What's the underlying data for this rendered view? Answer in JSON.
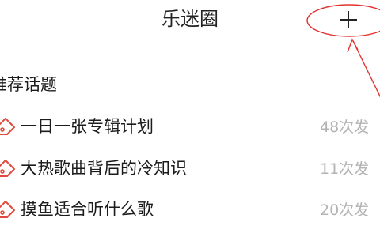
{
  "header": {
    "title": "乐迷圈",
    "add_icon": "plus-icon"
  },
  "section": {
    "title": "推荐话题"
  },
  "topics": [
    {
      "name": "一日一张专辑计划",
      "count": "48次发",
      "icon": "tag-icon"
    },
    {
      "name": "大热歌曲背后的冷知识",
      "count": "11次发",
      "icon": "tag-icon"
    },
    {
      "name": "摸鱼适合听什么歌",
      "count": "20次发",
      "icon": "tag-icon"
    }
  ],
  "colors": {
    "annotation_red": "#e2332f",
    "tag_red": "#e04a3f",
    "count_gray": "#b3b3b3"
  }
}
